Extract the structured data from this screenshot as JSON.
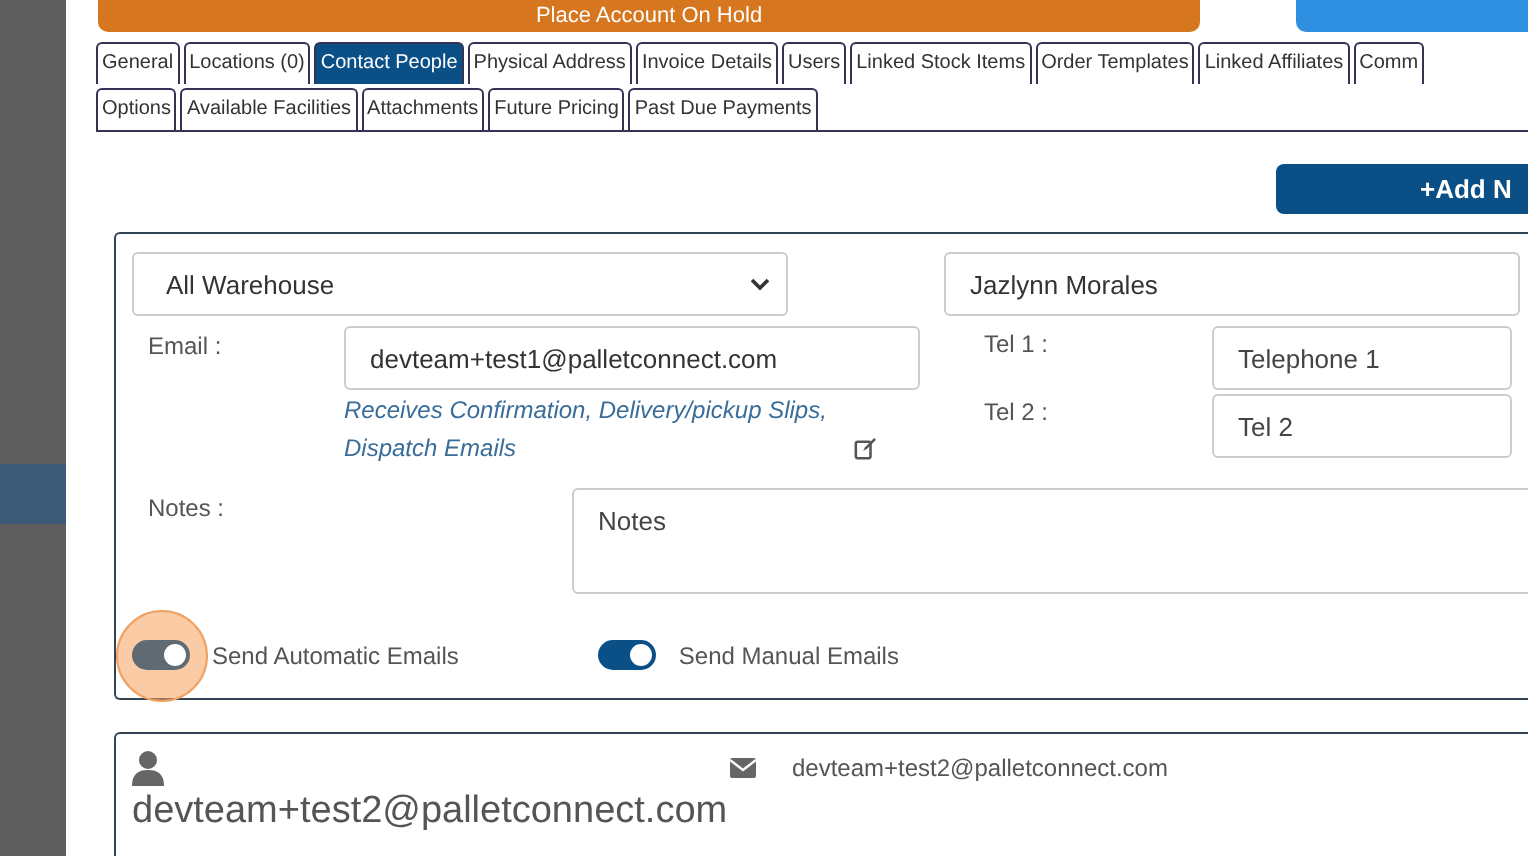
{
  "top_buttons": [
    {
      "label": "Place Account On Hold",
      "kind": "warning"
    },
    {
      "kind": "primary"
    }
  ],
  "tabs": [
    [
      {
        "label": "General",
        "selected": false
      },
      {
        "label": "Locations (0)",
        "selected": false
      },
      {
        "label": "Contact People",
        "selected": true
      },
      {
        "label": "Physical Address",
        "selected": false
      },
      {
        "label": "Invoice Details",
        "selected": false
      },
      {
        "label": "Users",
        "selected": false
      },
      {
        "label": "Linked Stock Items",
        "selected": false
      },
      {
        "label": "Order Templates",
        "selected": false
      },
      {
        "label": "Linked Affiliates",
        "selected": false
      },
      {
        "label": "Comm",
        "selected": false
      }
    ],
    [
      {
        "label": "Options",
        "selected": false
      },
      {
        "label": "Available Facilities",
        "selected": false
      },
      {
        "label": "Attachments",
        "selected": false
      },
      {
        "label": "Future Pricing",
        "selected": false
      },
      {
        "label": "Past Due Payments",
        "selected": false
      }
    ]
  ],
  "add_button": "+Add N",
  "contact_form": {
    "warehouse": "All Warehouse",
    "name": "Jazlynn Morales",
    "email_label": "Email :",
    "email": "devteam+test1@palletconnect.com",
    "email_note": "Receives Confirmation, Delivery/pickup Slips, Dispatch Emails",
    "tel1_label": "Tel 1 :",
    "tel1_placeholder": "Telephone 1",
    "tel2_label": "Tel 2 :",
    "tel2_placeholder": "Tel 2",
    "notes_label": "Notes :",
    "notes_placeholder": "Notes",
    "toggles": [
      {
        "label": "Send Automatic Emails",
        "on": true,
        "disabled": true,
        "highlighted": true
      },
      {
        "label": "Send Manual Emails",
        "on": true,
        "disabled": false,
        "highlighted": false
      }
    ]
  },
  "contact_card": {
    "email": "devteam+test2@palletconnect.com",
    "title": "devteam+test2@palletconnect.com"
  }
}
